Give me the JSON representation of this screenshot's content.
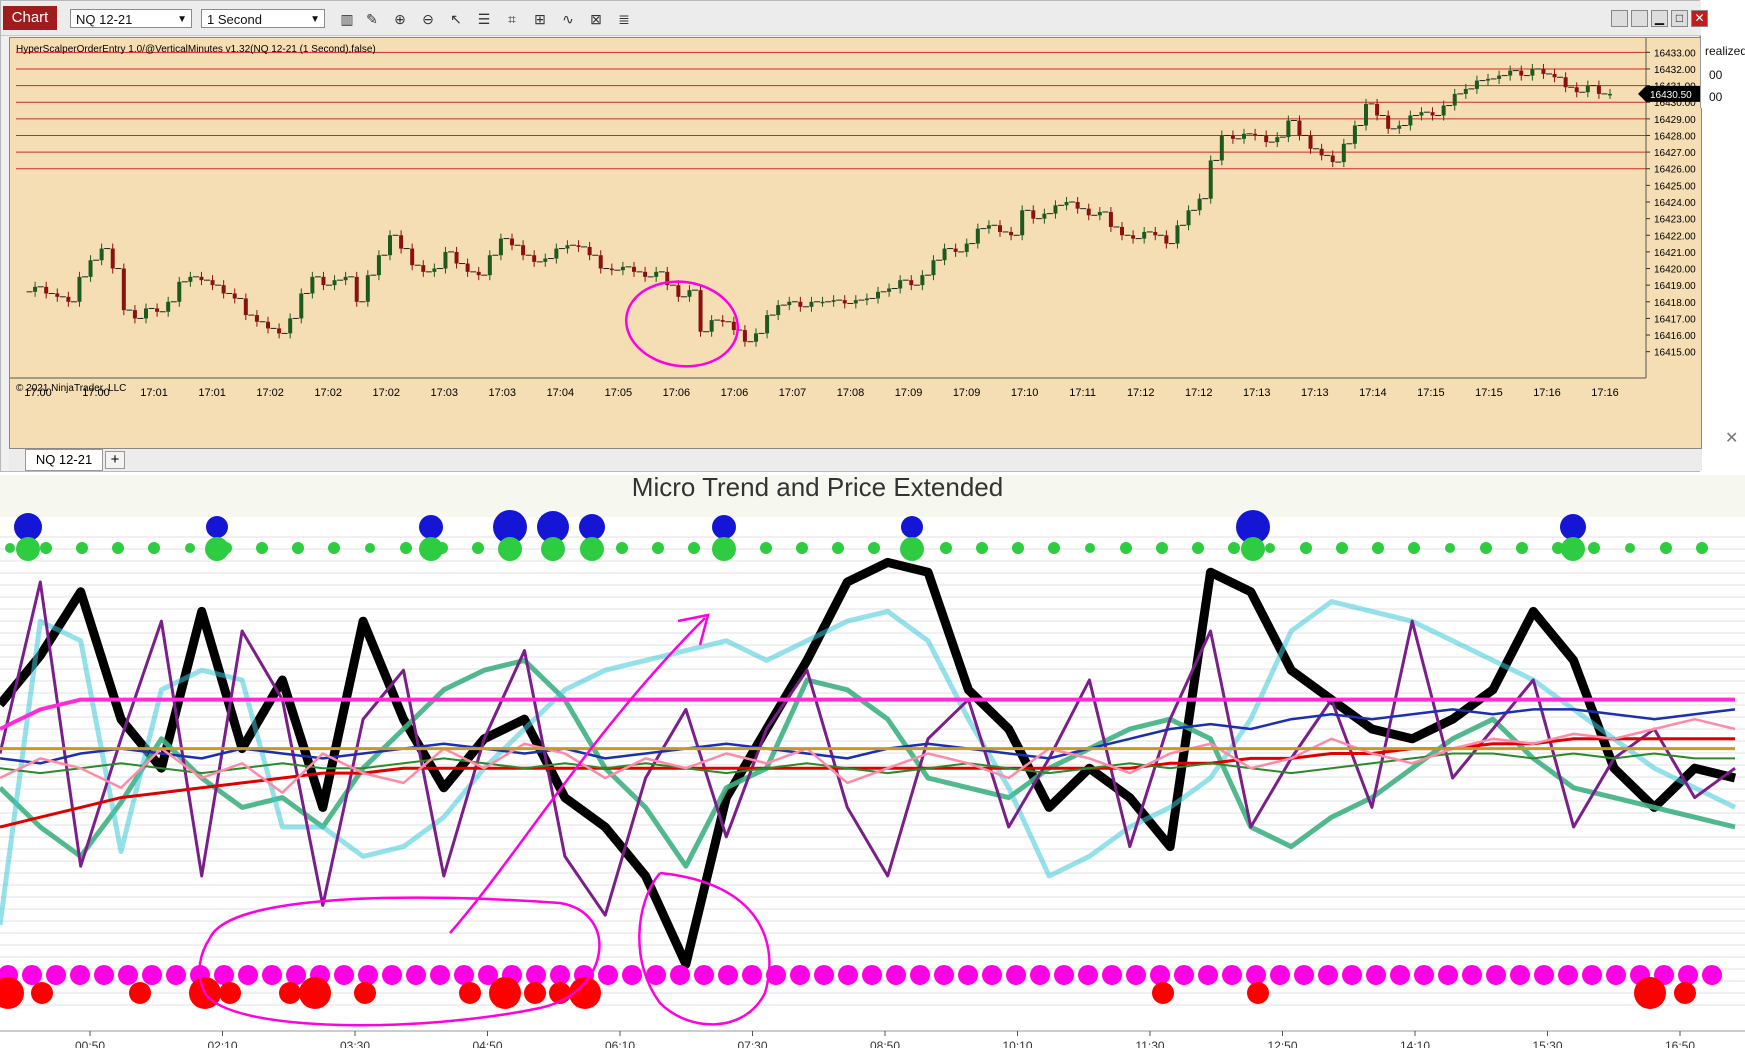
{
  "toolbar": {
    "chart_label": "Chart",
    "instrument": "NQ 12-21",
    "interval": "1 Second",
    "tools": [
      "bar-chart-icon",
      "pencil-icon",
      "zoom-in-icon",
      "zoom-out-icon",
      "cursor-icon",
      "properties-icon",
      "data-box-icon",
      "strategies-icon",
      "indicators-icon",
      "chart-trader-icon",
      "list-icon"
    ],
    "window_buttons": [
      "restore-icon",
      "tile-icon",
      "minimize-icon",
      "maximize-icon",
      "close-icon"
    ]
  },
  "top_chart": {
    "indicator_label": "HyperScalperOrderEntry 1.0/@VerticalMinutes v1.32(NQ 12-21 (1 Second),false)",
    "copyright": "© 2021 NinjaTrader, LLC",
    "last_price": "16430.50",
    "y_labels": [
      "16433.00",
      "16432.00",
      "16431.00",
      "16430.00",
      "16429.00",
      "16428.00",
      "16427.00",
      "16426.00",
      "16425.00",
      "16424.00",
      "16423.00",
      "16422.00",
      "16421.00",
      "16420.00",
      "16419.00",
      "16418.00",
      "16417.00",
      "16416.00",
      "16415.00"
    ],
    "x_labels": [
      "17:00",
      "17:00",
      "17:01",
      "17:01",
      "17:02",
      "17:02",
      "17:02",
      "17:03",
      "17:03",
      "17:04",
      "17:05",
      "17:06",
      "17:06",
      "17:07",
      "17:08",
      "17:09",
      "17:09",
      "17:10",
      "17:11",
      "17:12",
      "17:12",
      "17:13",
      "17:13",
      "17:14",
      "17:15",
      "17:15",
      "17:16",
      "17:16"
    ],
    "horizontal_line_levels": [
      16433,
      16432,
      16431,
      16430,
      16429,
      16428,
      16427,
      16426
    ],
    "colors": {
      "background": "#f5deb3",
      "up": "#1d5a1d",
      "down": "#8b1010",
      "level_line": "#cc2a2a",
      "annotation": "#ff00e0"
    }
  },
  "tabs": {
    "active": "NQ 12-21",
    "add": "+"
  },
  "right_strip": {
    "line1": "realized",
    "line2": "00",
    "line3": "00"
  },
  "bottom_chart": {
    "title": "Micro Trend and Price Extended",
    "x_labels": [
      "00:50",
      "02:10",
      "03:30",
      "04:50",
      "06:10",
      "07:30",
      "08:50",
      "10:10",
      "11:30",
      "12:50",
      "14:10",
      "15:30",
      "16:50"
    ]
  },
  "chart_data": [
    {
      "type": "candlestick",
      "title": "",
      "xlabel": "",
      "ylabel": "",
      "ylim": [
        16414.5,
        16433.5
      ],
      "x_range": [
        "17:00",
        "17:16"
      ],
      "series": [
        {
          "name": "",
          "values": [
            16418.6,
            16418.9,
            16418.5,
            16418.3,
            16418.0,
            16419.5,
            16420.5,
            16421.2,
            16420.0,
            16417.5,
            16417.0,
            16417.6,
            16417.4,
            16418.0,
            16419.2,
            16419.5,
            16419.3,
            16419.0,
            16418.5,
            16418.2,
            16417.2,
            16416.8,
            16416.4,
            16416.1,
            16417.0,
            16418.5,
            16419.5,
            16419.0,
            16419.3,
            16419.5,
            16418.0,
            16419.6,
            16420.8,
            16422.0,
            16421.2,
            16420.2,
            16419.8,
            16420.0,
            16421.0,
            16420.3,
            16419.8,
            16419.6,
            16420.8,
            16421.8,
            16421.4,
            16420.8,
            16420.4,
            16420.6,
            16421.2,
            16421.4,
            16421.3,
            16420.8,
            16420.0,
            16419.9,
            16420.1,
            16419.8,
            16419.5,
            16419.8,
            16419.0,
            16418.3,
            16418.7,
            16416.2,
            16416.9,
            16416.8,
            16416.3,
            16415.6,
            16416.1,
            16417.2,
            16417.8,
            16418.0,
            16417.7,
            16418.0,
            16418.0,
            16418.1,
            16417.9,
            16418.1,
            16418.2,
            16418.6,
            16418.8,
            16419.3,
            16419.0,
            16419.6,
            16420.5,
            16421.2,
            16421.0,
            16421.5,
            16422.4,
            16422.6,
            16422.2,
            16422.0,
            16423.5,
            16423.0,
            16423.3,
            16423.8,
            16424.0,
            16423.6,
            16423.2,
            16423.4,
            16422.5,
            16422.0,
            16421.8,
            16422.2,
            16422.0,
            16421.5,
            16422.6,
            16423.5,
            16424.2,
            16426.5,
            16428.0,
            16427.8,
            16428.1,
            16428.0,
            16427.6,
            16427.9,
            16428.9,
            16428.0,
            16427.2,
            16426.8,
            16426.4,
            16427.5,
            16428.6,
            16429.9,
            16429.2,
            16428.4,
            16428.6,
            16429.2,
            16429.4,
            16429.2,
            16429.8,
            16430.5,
            16430.8,
            16431.3,
            16431.4,
            16431.6,
            16431.9,
            16431.6,
            16432.0,
            16431.7,
            16431.5,
            16430.9,
            16430.6,
            16431.0,
            16430.5,
            16430.5
          ]
        }
      ],
      "price_levels": [
        16433,
        16432,
        16431,
        16430,
        16429,
        16428,
        16427,
        16426
      ],
      "last_price": 16430.5,
      "annotations": [
        {
          "shape": "ellipse",
          "near_time": "17:06"
        }
      ]
    },
    {
      "type": "line",
      "title": "Micro Trend and Price Extended",
      "xlabel": "",
      "ylabel": "",
      "x_labels": [
        "00:50",
        "02:10",
        "03:30",
        "04:50",
        "06:10",
        "07:30",
        "08:50",
        "10:10",
        "11:30",
        "12:50",
        "14:10",
        "15:30",
        "16:50"
      ],
      "ylim": [
        0,
        100
      ],
      "series": [
        {
          "name": "",
          "color": "#000000",
          "values": [
            65,
            75,
            88,
            62,
            52,
            84,
            56,
            70,
            44,
            82,
            62,
            48,
            58,
            62,
            46,
            40,
            30,
            12,
            46,
            60,
            74,
            90,
            94,
            92,
            68,
            60,
            44,
            52,
            46,
            36,
            92,
            88,
            72,
            66,
            60,
            58,
            62,
            68,
            84,
            74,
            52,
            44,
            52,
            50
          ]
        },
        {
          "name": "",
          "color": "#3fb081",
          "values": [
            48,
            40,
            34,
            45,
            58,
            50,
            44,
            46,
            40,
            52,
            60,
            68,
            72,
            74,
            66,
            52,
            44,
            32,
            48,
            52,
            70,
            68,
            62,
            50,
            48,
            46,
            52,
            56,
            60,
            62,
            58,
            40,
            36,
            42,
            46,
            52,
            58,
            62,
            54,
            48,
            46,
            44,
            42,
            40
          ]
        },
        {
          "name": "",
          "color": "#3cc8d8",
          "values": [
            20,
            82,
            78,
            35,
            68,
            72,
            70,
            40,
            40,
            34,
            36,
            42,
            52,
            60,
            68,
            72,
            74,
            76,
            78,
            74,
            78,
            82,
            84,
            78,
            62,
            48,
            30,
            34,
            40,
            44,
            50,
            62,
            80,
            86,
            84,
            82,
            78,
            74,
            70,
            64,
            58,
            52,
            48,
            44
          ]
        },
        {
          "name": "",
          "color": "#7a1f8a",
          "values": [
            55,
            90,
            32,
            58,
            82,
            30,
            80,
            66,
            24,
            62,
            72,
            30,
            58,
            76,
            34,
            22,
            50,
            64,
            38,
            60,
            72,
            44,
            30,
            58,
            66,
            40,
            54,
            70,
            36,
            62,
            80,
            40,
            54,
            66,
            44,
            82,
            50,
            60,
            70,
            40,
            54,
            60,
            46,
            52
          ]
        },
        {
          "name": "",
          "color": "#ff2bd6",
          "values": [
            60,
            64,
            66,
            66,
            66,
            66,
            66,
            66,
            66,
            66,
            66,
            66,
            66,
            66,
            66,
            66,
            66,
            66,
            66,
            66,
            66,
            66,
            66,
            66,
            66,
            66,
            66,
            66,
            66,
            66,
            66,
            66,
            66,
            66,
            66,
            66,
            66,
            66,
            66,
            66,
            66,
            66,
            66,
            66
          ]
        },
        {
          "name": "",
          "color": "#e00000",
          "values": [
            40,
            42,
            44,
            46,
            47,
            48,
            49,
            50,
            51,
            51,
            52,
            52,
            52,
            52,
            52,
            52,
            52,
            52,
            52,
            52,
            52,
            52,
            52,
            52,
            52,
            52,
            52,
            52,
            52,
            53,
            53,
            54,
            54,
            55,
            55,
            56,
            56,
            57,
            57,
            58,
            58,
            58,
            58,
            58
          ]
        },
        {
          "name": "",
          "color": "#1c2fb0",
          "values": [
            54,
            53,
            55,
            56,
            55,
            54,
            56,
            55,
            54,
            55,
            56,
            57,
            56,
            55,
            56,
            54,
            55,
            56,
            57,
            56,
            55,
            54,
            56,
            57,
            56,
            55,
            54,
            56,
            58,
            60,
            61,
            60,
            62,
            63,
            62,
            63,
            64,
            63,
            64,
            64,
            63,
            62,
            63,
            64
          ]
        },
        {
          "name": "",
          "color": "#2a8a2a",
          "values": [
            52,
            51,
            52,
            53,
            52,
            51,
            52,
            53,
            52,
            52,
            53,
            54,
            53,
            52,
            53,
            52,
            53,
            52,
            51,
            52,
            53,
            52,
            51,
            52,
            53,
            52,
            51,
            52,
            53,
            52,
            53,
            52,
            51,
            52,
            53,
            54,
            55,
            55,
            54,
            55,
            54,
            55,
            54,
            54
          ]
        },
        {
          "name": "",
          "color": "#ff8aa8",
          "values": [
            50,
            54,
            52,
            48,
            56,
            50,
            53,
            47,
            55,
            51,
            49,
            56,
            52,
            57,
            55,
            50,
            54,
            52,
            55,
            53,
            56,
            49,
            52,
            55,
            53,
            50,
            56,
            54,
            51,
            55,
            57,
            52,
            54,
            58,
            55,
            53,
            56,
            58,
            57,
            59,
            58,
            60,
            62,
            60
          ]
        },
        {
          "name": "",
          "color": "#c89a20",
          "values": [
            56,
            56,
            56,
            56,
            56,
            56,
            56,
            56,
            56,
            56,
            56,
            56,
            56,
            56,
            56,
            56,
            56,
            56,
            56,
            56,
            56,
            56,
            56,
            56,
            56,
            56,
            56,
            56,
            56,
            56,
            56,
            56,
            56,
            56,
            56,
            56,
            56,
            56,
            56,
            56,
            56,
            56,
            56,
            56
          ]
        }
      ],
      "markers": {
        "blue": [
          "00:50",
          "02:10",
          "03:30",
          "04:50",
          "06:10",
          "07:30",
          "08:50",
          "12:50",
          "15:30"
        ],
        "green_row": "top",
        "magenta_row": "bottom",
        "red_row": "bottom"
      }
    }
  ]
}
